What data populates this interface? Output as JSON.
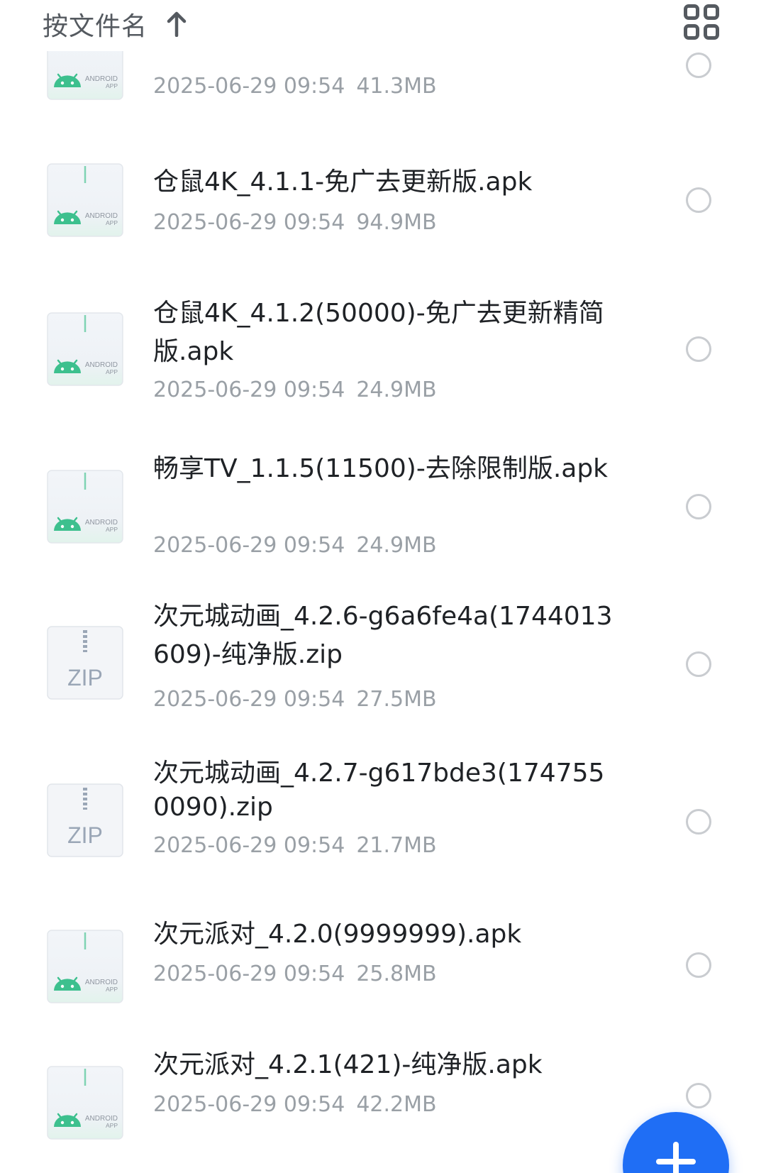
{
  "header": {
    "sort_label": "按文件名",
    "sort_icon": "arrow-up-icon",
    "view_icon": "grid-view-icon"
  },
  "files": [
    {
      "name": "",
      "date": "2025-06-29 09:54",
      "size": "41.3MB",
      "type": "apk"
    },
    {
      "name": "仓鼠4K_4.1.1-免广去更新版.apk",
      "date": "2025-06-29 09:54",
      "size": "94.9MB",
      "type": "apk"
    },
    {
      "name": "仓鼠4K_4.1.2(50000)-免广去更新精简版.apk",
      "date": "2025-06-29 09:54",
      "size": "24.9MB",
      "type": "apk"
    },
    {
      "name": "畅享TV_1.1.5(11500)-去除限制版.apk",
      "date": "2025-06-29 09:54",
      "size": "24.9MB",
      "type": "apk"
    },
    {
      "name": "次元城动画_4.2.6-g6a6fe4a(1744013609)-纯净版.zip",
      "date": "2025-06-29 09:54",
      "size": "27.5MB",
      "type": "zip"
    },
    {
      "name": "次元城动画_4.2.7-g617bde3(1747550090).zip",
      "date": "2025-06-29 09:54",
      "size": "21.7MB",
      "type": "zip"
    },
    {
      "name": "次元派对_4.2.0(9999999).apk",
      "date": "2025-06-29 09:54",
      "size": "25.8MB",
      "type": "apk"
    },
    {
      "name": "次元派对_4.2.1(421)-纯净版.apk",
      "date": "2025-06-29 09:54",
      "size": "42.2MB",
      "type": "apk"
    }
  ],
  "icon_labels": {
    "android_line1": "ANDROID",
    "android_line2": "APP",
    "zip": "ZIP"
  },
  "colors": {
    "accent": "#1f6ef5",
    "android_green": "#3dc08e"
  },
  "fab": {
    "icon": "plus-icon"
  }
}
